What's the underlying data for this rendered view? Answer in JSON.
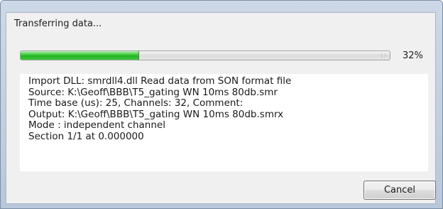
{
  "dialog": {
    "status_text": "Transferring data...",
    "progress": {
      "percent_value": 32,
      "percent_label": "32%"
    },
    "log_lines": [
      "Import DLL: smrdll4.dll Read data from SON format file",
      "Source: K:\\Geoff\\BBB\\T5_gating WN 10ms 80db.smr",
      "Time base (us): 25, Channels: 32, Comment:",
      "Output: K:\\Geoff\\BBB\\T5_gating WN 10ms 80db.smrx",
      "Mode  : independent channel",
      "Section 1/1 at 0.000000"
    ],
    "cancel_label": "Cancel"
  },
  "colors": {
    "progress_fill": "#22b522",
    "dialog_background": "#f0f0f0",
    "frame": "#b8c7da"
  }
}
